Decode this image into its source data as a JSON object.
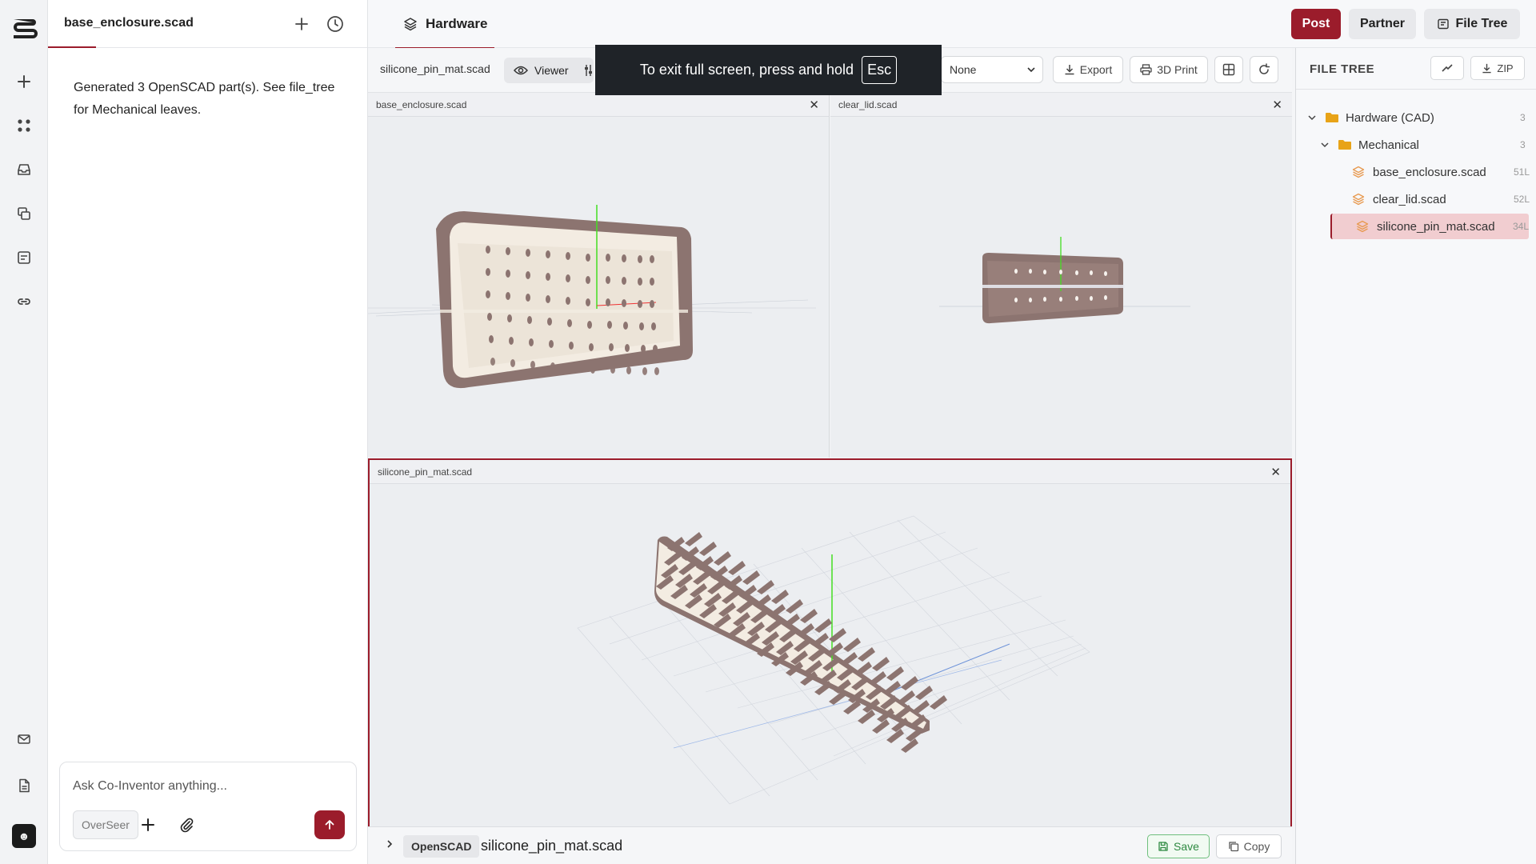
{
  "chat": {
    "tab_title": "base_enclosure.scad",
    "message": "Generated 3 OpenSCAD part(s). See file_tree for Mechanical leaves.",
    "input_placeholder": "Ask Co-Inventor anything...",
    "agent_label": "OverSeer"
  },
  "header": {
    "tab_label": "Hardware",
    "post_label": "Post",
    "partner_label": "Partner",
    "file_tree_label": "File Tree"
  },
  "toolbar": {
    "current_file": "silicone_pin_mat.scad",
    "viewer_label": "Viewer",
    "select_value": "None",
    "export_label": "Export",
    "print_label": "3D Print"
  },
  "toast": {
    "text": "To exit full screen, press and hold",
    "key": "Esc"
  },
  "viewports": [
    {
      "name": "base_enclosure.scad"
    },
    {
      "name": "clear_lid.scad"
    },
    {
      "name": "silicone_pin_mat.scad"
    }
  ],
  "codebar": {
    "language": "OpenSCAD",
    "filename": "silicone_pin_mat.scad",
    "save_label": "Save",
    "copy_label": "Copy"
  },
  "file_tree": {
    "title": "FILE TREE",
    "zip_label": "ZIP",
    "root": {
      "label": "Hardware (CAD)",
      "count": "3"
    },
    "folder": {
      "label": "Mechanical",
      "count": "3"
    },
    "files": [
      {
        "label": "base_enclosure.scad",
        "lines": "51L"
      },
      {
        "label": "clear_lid.scad",
        "lines": "52L"
      },
      {
        "label": "silicone_pin_mat.scad",
        "lines": "34L"
      }
    ]
  },
  "colors": {
    "accent": "#9b1c2b",
    "model": "#8c7470",
    "model_light": "#f3ece2",
    "axis_green": "#44dd22",
    "save_green": "#2e8a41"
  }
}
